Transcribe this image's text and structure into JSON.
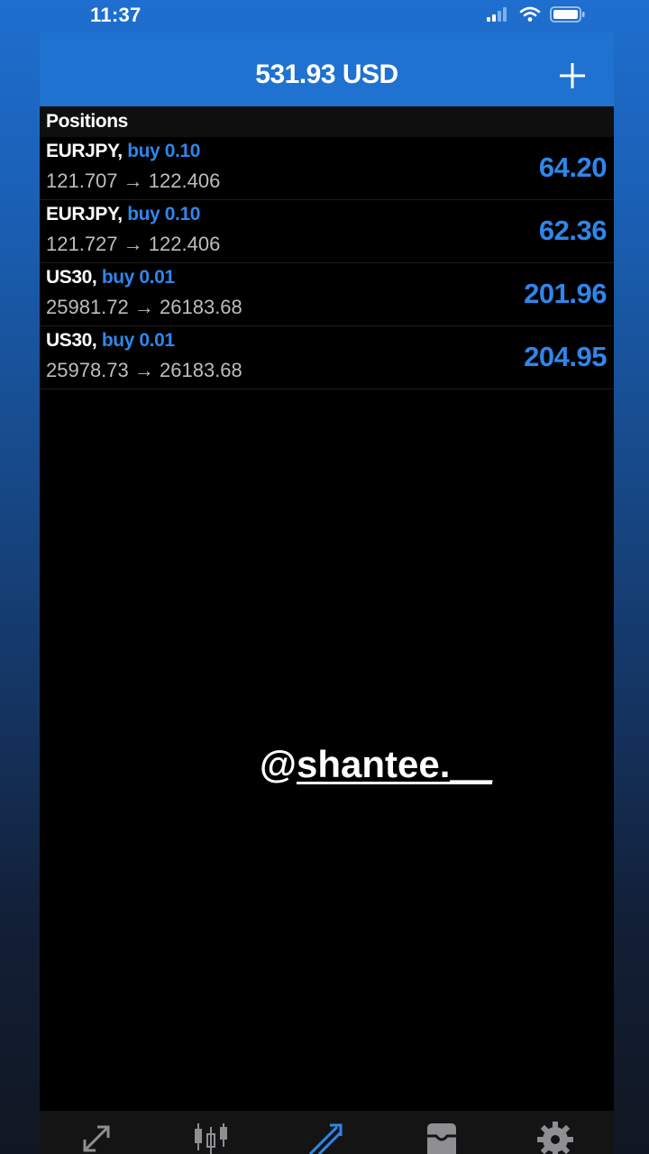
{
  "status_bar": {
    "time": "11:37",
    "icons": [
      "signal-icon",
      "wifi-icon",
      "battery-icon"
    ]
  },
  "header": {
    "balance": "531.93 USD",
    "add_icon": "plus-icon"
  },
  "section": {
    "title": "Positions"
  },
  "positions": [
    {
      "symbol": "EURJPY,",
      "side": "buy 0.10",
      "open_price": "121.707",
      "current_price": "122.406",
      "profit": "64.20"
    },
    {
      "symbol": "EURJPY,",
      "side": "buy 0.10",
      "open_price": "121.727",
      "current_price": "122.406",
      "profit": "62.36"
    },
    {
      "symbol": "US30,",
      "side": "buy 0.01",
      "open_price": "25981.72",
      "current_price": "26183.68",
      "profit": "201.96"
    },
    {
      "symbol": "US30,",
      "side": "buy 0.01",
      "open_price": "25978.73",
      "current_price": "26183.68",
      "profit": "204.95"
    }
  ],
  "arrow_glyph": "→",
  "watermark": {
    "at": "@",
    "name": "shantee.__"
  },
  "tabs": [
    {
      "icon": "quotes-icon",
      "active": false
    },
    {
      "icon": "chart-icon",
      "active": false
    },
    {
      "icon": "trade-icon",
      "active": true
    },
    {
      "icon": "history-icon",
      "active": false
    },
    {
      "icon": "settings-icon",
      "active": false
    }
  ],
  "colors": {
    "accent": "#2f86ec",
    "header": "#1f72cf",
    "background": "#000000"
  }
}
